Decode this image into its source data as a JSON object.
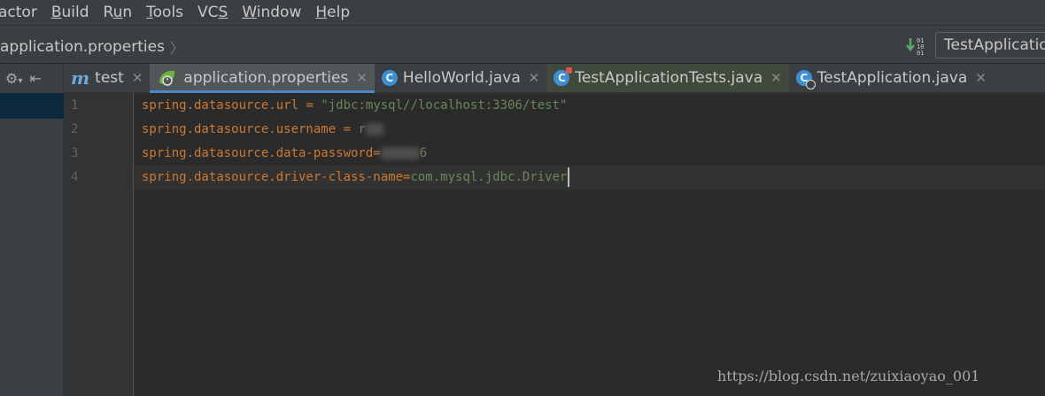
{
  "menu": {
    "items": [
      {
        "pre": "",
        "ul": "",
        "post": "actor"
      },
      {
        "pre": "",
        "ul": "B",
        "post": "uild"
      },
      {
        "pre": "R",
        "ul": "u",
        "post": "n"
      },
      {
        "pre": "",
        "ul": "T",
        "post": "ools"
      },
      {
        "pre": "VC",
        "ul": "S",
        "post": ""
      },
      {
        "pre": "",
        "ul": "W",
        "post": "indow"
      },
      {
        "pre": "",
        "ul": "H",
        "post": "elp"
      }
    ]
  },
  "navbar": {
    "breadcrumb": "application.properties",
    "run_config": "TestApplication"
  },
  "tabs": [
    {
      "label": "test",
      "icon": "module-m-icon"
    },
    {
      "label": "application.properties",
      "icon": "spring-boot-icon",
      "active": true
    },
    {
      "label": "HelloWorld.java",
      "icon": "class-icon"
    },
    {
      "label": "TestApplicationTests.java",
      "icon": "test-class-icon"
    },
    {
      "label": "TestApplication.java",
      "icon": "spring-class-icon"
    }
  ],
  "editor": {
    "lines": [
      {
        "num": "1",
        "key": "spring.datasource.url",
        "sep": " = ",
        "value": "\"jdbc:mysql//localhost:3306/test\""
      },
      {
        "num": "2",
        "key": "spring.datasource.username",
        "sep": " = ",
        "value": "r"
      },
      {
        "num": "3",
        "key": "spring.datasource.data-password",
        "sep": "=",
        "value": "6"
      },
      {
        "num": "4",
        "key": "spring.datasource.driver-class-name",
        "sep": "=",
        "value": "com.mysql.jdbc.Driver"
      }
    ]
  },
  "watermark": "https://blog.csdn.net/zuixiaoyao_001",
  "colors": {
    "background": "#2b2b2b",
    "key": "#cc7832",
    "value": "#6a8759",
    "active_tab_underline": "#4a88c7",
    "spring": "#6db33f"
  }
}
